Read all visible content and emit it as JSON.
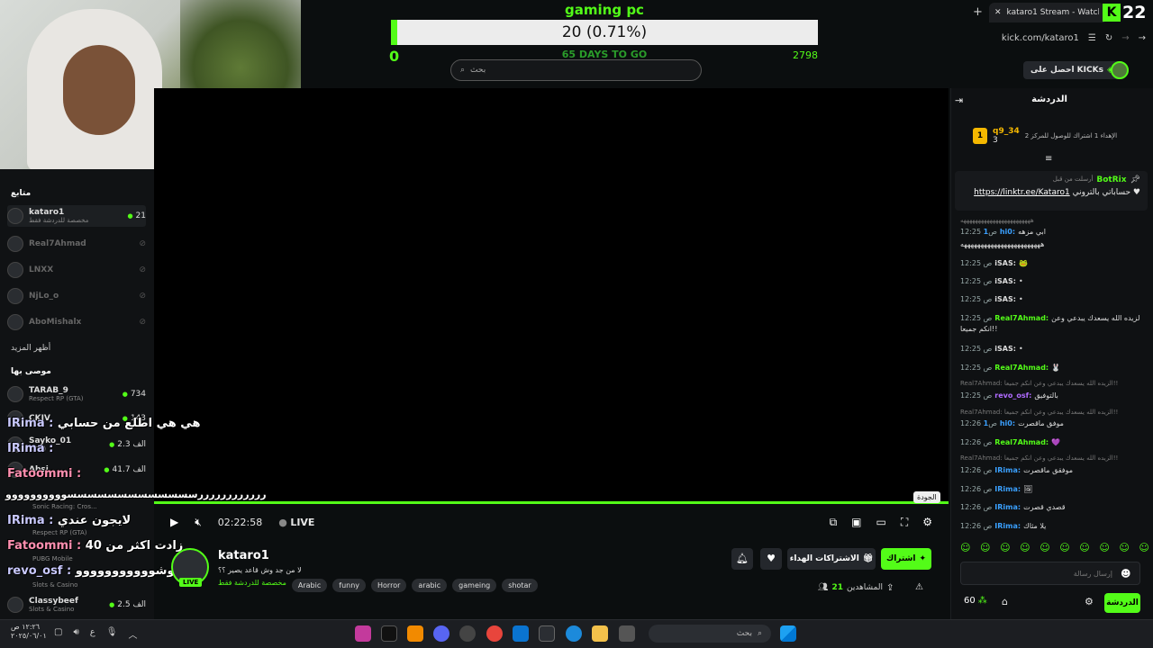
{
  "goal": {
    "title": "gaming pc",
    "value_text": "20 (0.71%)",
    "progress_fraction": 0.0071,
    "start": "0",
    "end": "2798",
    "days_left": "65 DAYS TO GO"
  },
  "browser": {
    "tab_title": "kataro1 Stream - Watch Live",
    "url": "kick.com/kataro1",
    "badge_number": "22",
    "badge_letter": "K"
  },
  "search": {
    "placeholder": "بحث"
  },
  "get_kicks": "احصل على KICKs",
  "player": {
    "time": "02:22:58",
    "live_label": "LIVE",
    "quality_tooltip": "الجودة"
  },
  "sidebar": {
    "following_heading": "متابع",
    "show_more": "أظهر المزيد",
    "recommended_heading": "موصى بها",
    "following": [
      {
        "name": "kataro1",
        "sub": "مخصصة للدردشة فقط",
        "count": "21",
        "live": true
      },
      {
        "name": "Real7Ahmad",
        "live": false
      },
      {
        "name": "LNXX",
        "live": false
      },
      {
        "name": "NjLo_o",
        "live": false
      },
      {
        "name": "AboMishalx",
        "live": false
      }
    ],
    "recommended": [
      {
        "name": "TARAB_9",
        "sub": "Respect RP (GTA)",
        "count": "734"
      },
      {
        "name": "CKIV",
        "sub": "",
        "count": "143"
      },
      {
        "name": "Sayko_01",
        "sub": "(GTA)",
        "count": "الف 2.3"
      },
      {
        "name": "Absi",
        "sub": "",
        "count": "الف 41.7"
      },
      {
        "name": "",
        "sub": "Sonic Racing: Cros...",
        "count": ""
      },
      {
        "name": "",
        "sub": "Respect RP (GTA)",
        "count": ""
      },
      {
        "name": "",
        "sub": "PUBG Mobile",
        "count": ""
      },
      {
        "name": "",
        "sub": "Slots & Casino",
        "count": ""
      },
      {
        "name": "Classybeef",
        "sub": "Slots & Casino",
        "count": "الف 2.5"
      }
    ]
  },
  "overlay_chat": [
    {
      "user": "IRima :",
      "text": "هي هي اطلع من حسابي"
    },
    {
      "user": "IRima :",
      "text": ""
    },
    {
      "user": "Fatoommi :",
      "text": ""
    },
    {
      "user": "",
      "text": "ررررررررررررسسسسسسسسسسسسسوووووووووو"
    },
    {
      "user": "IRima :",
      "text": "لايجون عندي"
    },
    {
      "user": "Fatoommi :",
      "text": "زادت اكثر من 40"
    },
    {
      "user": "revo_osf :",
      "text": "يمه وشووووووووووو"
    }
  ],
  "stream": {
    "streamer": "kataro1",
    "live_badge": "LIVE",
    "title": "لا من جد وش قاعد يصير ؟؟",
    "category": "مخصصة للدردشة فقط",
    "tags": [
      "Arabic",
      "funny",
      "Horror",
      "arabic",
      "gameing",
      "shotar"
    ],
    "subscribe_label": "اشتراك",
    "gift_label": "الاشتراكات الهداء",
    "viewers_label": "المشاهدين",
    "viewers": "21"
  },
  "chat": {
    "title": "الدردشة",
    "leader": {
      "rank": "1",
      "name": "q9_34",
      "points": "3",
      "info": "الإهداء 1 اشتراك للوصول للمركز 2"
    },
    "pinned": {
      "user": "BotRix",
      "meta": "أرسلت من قبل",
      "text": "حساباتي بالتروني ♥",
      "link": "https://linktr.ee/Kataro1"
    },
    "messages": [
      {
        "time": "",
        "user": "",
        "text": "ههههههههههههههههههههههههه",
        "color": "#dddddd",
        "reply": true
      },
      {
        "time": "12:25 ص",
        "user": "1hi0:",
        "text": "ابي مزهه",
        "color": "#3aa0ff"
      },
      {
        "time": "",
        "user": "",
        "text": "ههههههههههههههههههههههههه",
        "color": "#dddddd"
      },
      {
        "time": "12:25 ص",
        "user": "iSAS:",
        "text": "🐸",
        "color": "#ffffff"
      },
      {
        "time": "12:25 ص",
        "user": "iSAS:",
        "text": "•",
        "color": "#ffffff"
      },
      {
        "time": "12:25 ص",
        "user": "iSAS:",
        "text": "•",
        "color": "#ffffff"
      },
      {
        "time": "12:25 ص",
        "user": "Real7Ahmad:",
        "text": "الزيده الله يسعدك يبدعي وعن",
        "color": "#53fc18"
      },
      {
        "time": "",
        "user": "",
        "text": "انكم جميعا!!",
        "color": "#dddddd"
      },
      {
        "time": "12:25 ص",
        "user": "iSAS:",
        "text": "•",
        "color": "#ffffff"
      },
      {
        "time": "12:25 ص",
        "user": "Real7Ahmad:",
        "text": "🐰",
        "color": "#53fc18"
      },
      {
        "time": "",
        "user": "",
        "text": "Real7Ahmad: الزيده الله يسعدك يبدعي وعن انكم جميعا!!",
        "color": "#777777",
        "reply": true
      },
      {
        "time": "12:25 ص",
        "user": "revo_osf:",
        "text": "بالتوفيق",
        "color": "#b06bff"
      },
      {
        "time": "",
        "user": "",
        "text": "Real7Ahmad: الزيده الله يسعدك يبدعي وعن انكم جميعا!!",
        "color": "#777777",
        "reply": true
      },
      {
        "time": "12:26 ص",
        "user": "1hi0:",
        "text": "موفق ماقصرت",
        "color": "#3aa0ff"
      },
      {
        "time": "12:26 ص",
        "user": "Real7Ahmad:",
        "text": "💜",
        "color": "#53fc18"
      },
      {
        "time": "",
        "user": "",
        "text": "Real7Ahmad: الزيده الله يسعدك يبدعي وعن انكم جميعا!!",
        "color": "#777777",
        "reply": true
      },
      {
        "time": "12:26 ص",
        "user": "IRima:",
        "text": "موفقق ماقصرت",
        "color": "#3aa0ff"
      },
      {
        "time": "12:26 ص",
        "user": "IRima:",
        "text": "🖼",
        "color": "#3aa0ff"
      },
      {
        "time": "12:26 ص",
        "user": "IRima:",
        "text": "قصدي قصرت",
        "color": "#3aa0ff"
      },
      {
        "time": "12:26 ص",
        "user": "IRima:",
        "text": "يلا مثاك",
        "color": "#3aa0ff"
      }
    ],
    "input_placeholder": "إرسال رسالة",
    "send_label": "الدردشة",
    "points": "60"
  },
  "taskbar": {
    "search_placeholder": "بحث",
    "time": "١٢:٢٦ ص",
    "date": "٢٠٢٥/٠٦/٠١"
  },
  "colors": {
    "accent": "#53fc18",
    "background": "#0b0e0f"
  }
}
